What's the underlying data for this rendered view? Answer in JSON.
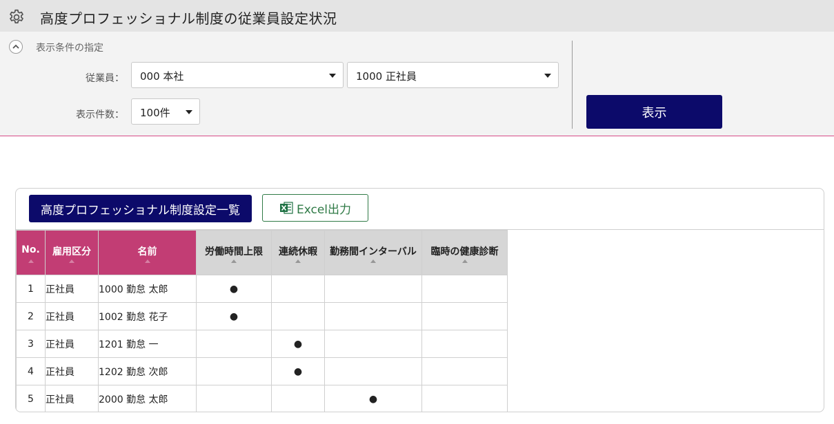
{
  "header": {
    "title": "高度プロフェッショナル制度の従業員設定状況",
    "icon": "gear-icon"
  },
  "filter": {
    "heading": "表示条件の指定",
    "employee_label": "従業員：",
    "employee_office": "000 本社",
    "employee_type": "1000 正社員",
    "count_label": "表示件数：",
    "count_value": "100件",
    "show_button": "表示"
  },
  "list": {
    "title_button": "高度プロフェッショナル制度設定一覧",
    "excel_button": "Excel出力",
    "columns": [
      "No.",
      "雇用区分",
      "名前",
      "労働時間上限",
      "連続休暇",
      "勤務間インターバル",
      "臨時の健康診断"
    ],
    "mark_symbol": "●",
    "rows": [
      {
        "no": "1",
        "kbn": "正社員",
        "name": "1000 勤怠 太郎",
        "marks": [
          "●",
          "",
          "",
          ""
        ]
      },
      {
        "no": "2",
        "kbn": "正社員",
        "name": "1002 勤怠 花子",
        "marks": [
          "●",
          "",
          "",
          ""
        ]
      },
      {
        "no": "3",
        "kbn": "正社員",
        "name": "1201 勤怠 一",
        "marks": [
          "",
          "●",
          "",
          ""
        ]
      },
      {
        "no": "4",
        "kbn": "正社員",
        "name": "1202 勤怠 次郎",
        "marks": [
          "",
          "●",
          "",
          ""
        ]
      },
      {
        "no": "5",
        "kbn": "正社員",
        "name": "2000 勤怠 太郎",
        "marks": [
          "",
          "",
          "●",
          ""
        ]
      }
    ]
  },
  "colors": {
    "navy": "#0c0a6a",
    "pink": "#c23d74",
    "excel_green": "#2f7a46"
  }
}
